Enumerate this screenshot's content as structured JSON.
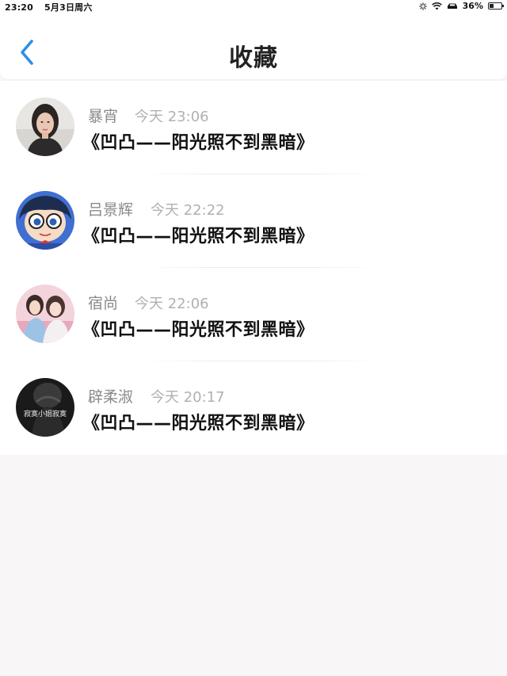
{
  "status_bar": {
    "time": "23:20",
    "date": "5月3日周六",
    "battery": "36%",
    "battery_level": 0.36,
    "icons": [
      "loading-icon",
      "wifi-icon",
      "car-icon",
      "battery-icon"
    ]
  },
  "header": {
    "title": "收藏",
    "back_icon": "chevron-left-icon"
  },
  "colors": {
    "accent": "#2e8ee6",
    "name": "#8a8a8a",
    "time": "#b0b0b0",
    "title": "#111111",
    "background": "#f8f6f7"
  },
  "favorites": [
    {
      "name": "暴宵",
      "time": "今天 23:06",
      "title": "《凹凸——阳光照不到黑暗》"
    },
    {
      "name": "吕景辉",
      "time": "今天 22:22",
      "title": "《凹凸——阳光照不到黑暗》"
    },
    {
      "name": "宿尚",
      "time": "今天 22:06",
      "title": "《凹凸——阳光照不到黑暗》"
    },
    {
      "name": "辟柔淑",
      "time": "今天 20:17",
      "title": "《凹凸——阳光照不到黑暗》",
      "avatar_text": "寂寞小姐寂寞"
    }
  ]
}
